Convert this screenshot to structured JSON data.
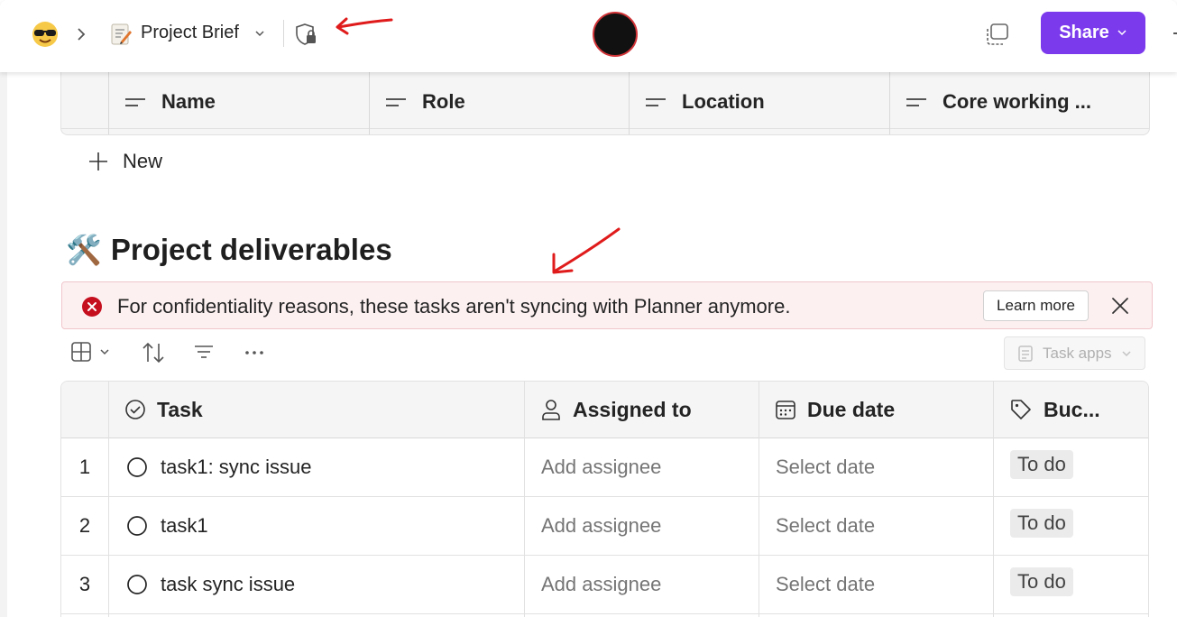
{
  "topbar": {
    "page_title": "Project Brief",
    "share_label": "Share",
    "icons": [
      "emoji-avatar-icon",
      "chevron-right-icon",
      "page-memo-icon",
      "chevron-down-icon",
      "shield-lock-icon",
      "copy-screen-icon",
      "more-icon"
    ]
  },
  "people_table": {
    "columns": [
      "Name",
      "Role",
      "Location",
      "Core working ..."
    ]
  },
  "new_label": "New",
  "section": {
    "emoji": "🛠️",
    "title": "Project deliverables"
  },
  "alert": {
    "message": "For confidentiality reasons, these tasks aren't syncing with Planner anymore.",
    "learn_more": "Learn more"
  },
  "toolbar": {
    "task_apps_label": "Task apps"
  },
  "task_table": {
    "headers": {
      "task": "Task",
      "assigned": "Assigned to",
      "due": "Due date",
      "bucket": "Buc..."
    },
    "rows": [
      {
        "num": "1",
        "task": "task1: sync issue",
        "assignee": "Add assignee",
        "due": "Select date",
        "bucket": "To do"
      },
      {
        "num": "2",
        "task": "task1",
        "assignee": "Add assignee",
        "due": "Select date",
        "bucket": "To do"
      },
      {
        "num": "3",
        "task": "task sync issue",
        "assignee": "Add assignee",
        "due": "Select date",
        "bucket": "To do"
      }
    ]
  },
  "colors": {
    "accent": "#7c3aed",
    "alert_bg": "#fdf0f1",
    "error": "#c50f1f",
    "annotation_arrow": "#e01b1b"
  }
}
